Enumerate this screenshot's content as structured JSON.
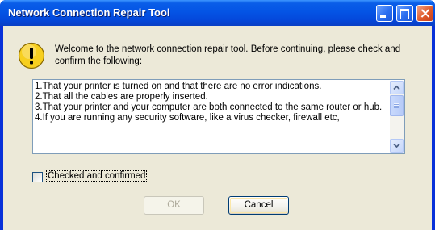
{
  "window": {
    "title": "Network Connection Repair Tool"
  },
  "dialog": {
    "intro": "Welcome to the network connection repair tool.  Before continuing, please check and confirm the following:",
    "list_lines": [
      "1.That your printer is turned on and that there are no error indications.",
      "2.That all the cables are properly inserted.",
      "3.That your printer and your computer are both connected to the same router or hub.",
      "4.If you are running any security software, like a virus checker, firewall etc,"
    ],
    "checkbox_label": "Checked and confirmed",
    "checkbox_checked": false,
    "ok_label": "OK",
    "ok_enabled": false,
    "cancel_label": "Cancel"
  },
  "icons": {
    "warning": "warning-icon",
    "minimize": "minimize-icon",
    "maximize": "maximize-icon",
    "close": "close-icon"
  },
  "colors": {
    "titlebar": "#0454e5",
    "client": "#ece9d8",
    "warning_yellow": "#f7cf1f"
  }
}
